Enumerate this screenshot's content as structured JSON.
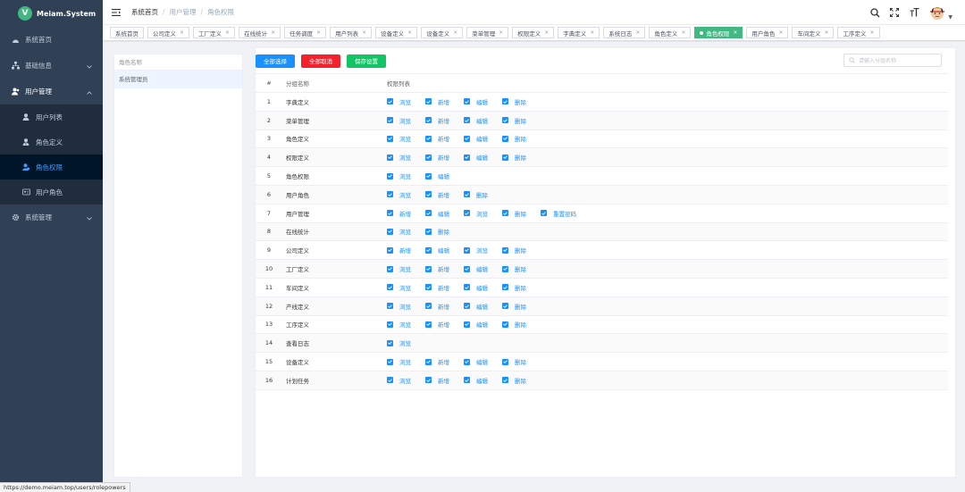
{
  "app": {
    "logo_letter": "V",
    "name": "Meiam.System"
  },
  "sidebar": {
    "items": [
      {
        "label": "系统首页"
      },
      {
        "label": "基础信息"
      },
      {
        "label": "用户管理"
      },
      {
        "label": "系统管理"
      }
    ],
    "user_submenu": [
      {
        "label": "用户列表"
      },
      {
        "label": "角色定义"
      },
      {
        "label": "角色权限"
      },
      {
        "label": "用户角色"
      }
    ]
  },
  "breadcrumb": {
    "home": "系统首页",
    "parent": "用户管理",
    "current": "角色权限"
  },
  "tags": [
    {
      "label": "系统首页"
    },
    {
      "label": "公司定义"
    },
    {
      "label": "工厂定义"
    },
    {
      "label": "在线统计"
    },
    {
      "label": "任务调度"
    },
    {
      "label": "用户列表"
    },
    {
      "label": "设备定义"
    },
    {
      "label": "设备定义"
    },
    {
      "label": "菜单管理"
    },
    {
      "label": "权限定义"
    },
    {
      "label": "字典定义"
    },
    {
      "label": "系统日志"
    },
    {
      "label": "角色定义"
    },
    {
      "label": "角色权限"
    },
    {
      "label": "用户角色"
    },
    {
      "label": "车间定义"
    },
    {
      "label": "工序定义"
    }
  ],
  "left": {
    "header": "角色名称",
    "row": "系统管理员"
  },
  "toolbar": {
    "select_all": "全部选择",
    "cancel_all": "全部取消",
    "save": "保存设置",
    "search_placeholder": "请输入分组名称"
  },
  "table": {
    "headers": {
      "idx": "#",
      "group": "分组名称",
      "perms": "权限列表"
    },
    "rows": [
      {
        "idx": "1",
        "name": "字典定义",
        "perms": [
          "浏览",
          "新增",
          "编辑",
          "删除"
        ]
      },
      {
        "idx": "2",
        "name": "菜单管理",
        "perms": [
          "浏览",
          "新增",
          "编辑",
          "删除"
        ]
      },
      {
        "idx": "3",
        "name": "角色定义",
        "perms": [
          "浏览",
          "新增",
          "编辑",
          "删除"
        ]
      },
      {
        "idx": "4",
        "name": "权限定义",
        "perms": [
          "浏览",
          "新增",
          "编辑",
          "删除"
        ]
      },
      {
        "idx": "5",
        "name": "角色权限",
        "perms": [
          "浏览",
          "编辑"
        ]
      },
      {
        "idx": "6",
        "name": "用户角色",
        "perms": [
          "浏览",
          "新增",
          "删除"
        ]
      },
      {
        "idx": "7",
        "name": "用户管理",
        "perms": [
          "新增",
          "编辑",
          "浏览",
          "删除",
          "重置密码"
        ]
      },
      {
        "idx": "8",
        "name": "在线统计",
        "perms": [
          "浏览",
          "删除"
        ]
      },
      {
        "idx": "9",
        "name": "公司定义",
        "perms": [
          "新增",
          "编辑",
          "浏览",
          "删除"
        ]
      },
      {
        "idx": "10",
        "name": "工厂定义",
        "perms": [
          "浏览",
          "新增",
          "编辑",
          "删除"
        ]
      },
      {
        "idx": "11",
        "name": "车间定义",
        "perms": [
          "浏览",
          "新增",
          "编辑",
          "删除"
        ]
      },
      {
        "idx": "12",
        "name": "产线定义",
        "perms": [
          "浏览",
          "新增",
          "编辑",
          "删除"
        ]
      },
      {
        "idx": "13",
        "name": "工序定义",
        "perms": [
          "浏览",
          "新增",
          "编辑",
          "删除"
        ]
      },
      {
        "idx": "14",
        "name": "查看日志",
        "perms": [
          "浏览"
        ]
      },
      {
        "idx": "15",
        "name": "设备定义",
        "perms": [
          "浏览",
          "新增",
          "编辑",
          "删除"
        ]
      },
      {
        "idx": "16",
        "name": "计划任务",
        "perms": [
          "浏览",
          "新增",
          "编辑",
          "删除"
        ]
      }
    ]
  },
  "status_url": "https://demo.meiam.top/users/rolepowers",
  "colors": {
    "sidebar": "#304156",
    "accent": "#1890ff",
    "active_tag": "#42b983"
  }
}
